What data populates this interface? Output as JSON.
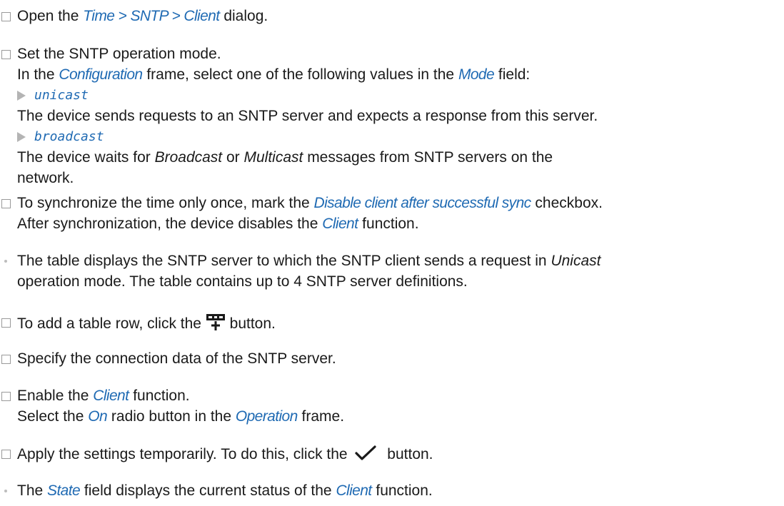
{
  "steps": {
    "open": {
      "pre": "Open the ",
      "menu": "Time > SNTP > Client",
      "post": " dialog."
    },
    "mode": {
      "title": "Set the SNTP operation mode.",
      "l2_pre": "In the ",
      "l2_frame": "Configuration",
      "l2_mid": " frame, select one of the following values in the ",
      "l2_field": "Mode",
      "l2_post": " field:",
      "opt1_value": "unicast",
      "opt1_desc": "The device sends requests to an SNTP server and expects a response from this server.",
      "opt2_value": "broadcast",
      "opt2_desc_pre": "The device waits for ",
      "opt2_broadcast": "Broadcast",
      "opt2_or": " or ",
      "opt2_multicast": "Multicast",
      "opt2_desc_post": " messages from SNTP servers on the",
      "opt2_desc_line2": "network."
    },
    "sync": {
      "pre": "To synchronize the time only once, mark the ",
      "checkbox": "Disable client after successful sync",
      "post": " checkbox.",
      "l2_pre": "After synchronization, the device disables the ",
      "l2_func": "Client",
      "l2_post": " function."
    },
    "table_info": {
      "l1_pre": "The table displays the SNTP server to which the SNTP client sends a request in ",
      "l1_mode": "Unicast",
      "l2": "operation mode. The table contains up to 4 SNTP server definitions."
    },
    "add_row": {
      "pre": "To add a table row, click the ",
      "post": " button."
    },
    "specify": {
      "text": "Specify the connection data of the SNTP server."
    },
    "enable": {
      "pre": "Enable the ",
      "func": "Client",
      "post": " function.",
      "l2_pre": "Select the ",
      "l2_on": "On",
      "l2_mid": " radio button in the ",
      "l2_frame": "Operation",
      "l2_post": " frame."
    },
    "apply": {
      "pre": "Apply the settings temporarily. To do this, click the ",
      "post": " button."
    },
    "state": {
      "pre": "The ",
      "field": "State",
      "mid": " field displays the current status of the ",
      "func": "Client",
      "post": " function."
    }
  },
  "icons": {
    "add_row": "add-table-row-icon",
    "apply": "checkmark-icon"
  },
  "colors": {
    "link": "#1f6ab3",
    "checkbox_border": "#9a9a9a",
    "bullet": "#bdbdbd",
    "triangle": "#b4b4b4"
  }
}
